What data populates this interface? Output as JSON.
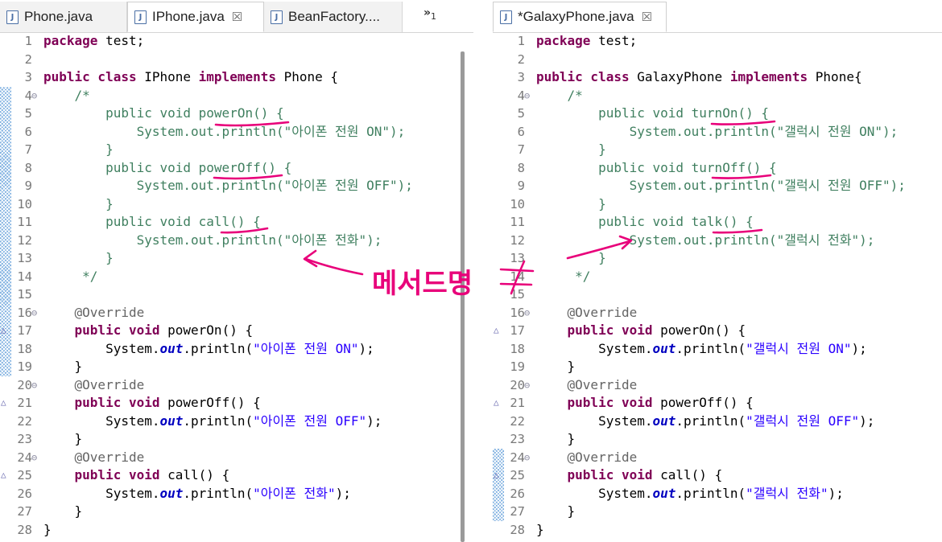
{
  "left_editor": {
    "tabs": [
      {
        "label": "Phone.java",
        "active": false,
        "closable": false
      },
      {
        "label": "IPhone.java",
        "active": true,
        "closable": true
      },
      {
        "label": "BeanFactory....",
        "active": false,
        "closable": false
      }
    ],
    "overflow_label": "»",
    "overflow_count": "1",
    "lines": [
      {
        "n": "1",
        "html": "<span class=\"kw\">package</span> test;"
      },
      {
        "n": "2",
        "html": ""
      },
      {
        "n": "3",
        "html": "<span class=\"kw\">public class</span> IPhone <span class=\"kw\">implements</span> Phone {"
      },
      {
        "n": "4",
        "fold": "⊖",
        "html": "    <span class=\"cm\">/*</span>"
      },
      {
        "n": "5",
        "html": "<span class=\"cm\">        public void powerOn() {</span>"
      },
      {
        "n": "6",
        "html": "<span class=\"cm\">            System.out.println(\"아이폰 전원 ON\");</span>"
      },
      {
        "n": "7",
        "html": "<span class=\"cm\">        }</span>"
      },
      {
        "n": "8",
        "html": "<span class=\"cm\">        public void powerOff() {</span>"
      },
      {
        "n": "9",
        "html": "<span class=\"cm\">            System.out.println(\"아이폰 전원 OFF\");</span>"
      },
      {
        "n": "10",
        "html": "<span class=\"cm\">        }</span>"
      },
      {
        "n": "11",
        "html": "<span class=\"cm\">        public void call() {</span>"
      },
      {
        "n": "12",
        "html": "<span class=\"cm\">            System.out.println(\"아이폰 전화\");</span>"
      },
      {
        "n": "13",
        "html": "<span class=\"cm\">        }</span>"
      },
      {
        "n": "14",
        "html": "<span class=\"cm\">     */</span>"
      },
      {
        "n": "15",
        "html": ""
      },
      {
        "n": "16",
        "fold": "⊖",
        "html": "    <span class=\"an\">@Override</span>"
      },
      {
        "n": "17",
        "ovr": true,
        "html": "    <span class=\"kw\">public void</span> powerOn() {"
      },
      {
        "n": "18",
        "html": "        System.<span class=\"fld\">out</span>.println(<span class=\"st\">\"아이폰 전원 ON\"</span>);"
      },
      {
        "n": "19",
        "html": "    }"
      },
      {
        "n": "20",
        "fold": "⊖",
        "html": "    <span class=\"an\">@Override</span>"
      },
      {
        "n": "21",
        "ovr": true,
        "html": "    <span class=\"kw\">public void</span> powerOff() {"
      },
      {
        "n": "22",
        "html": "        System.<span class=\"fld\">out</span>.println(<span class=\"st\">\"아이폰 전원 OFF\"</span>);"
      },
      {
        "n": "23",
        "html": "    }"
      },
      {
        "n": "24",
        "fold": "⊖",
        "html": "    <span class=\"an\">@Override</span>"
      },
      {
        "n": "25",
        "ovr": true,
        "html": "    <span class=\"kw\">public void</span> call() {"
      },
      {
        "n": "26",
        "html": "        System.<span class=\"fld\">out</span>.println(<span class=\"st\">\"아이폰 전화\"</span>);"
      },
      {
        "n": "27",
        "html": "    }"
      },
      {
        "n": "28",
        "html": "}"
      }
    ]
  },
  "right_editor": {
    "tabs": [
      {
        "label": "*GalaxyPhone.java",
        "active": true,
        "closable": true
      }
    ],
    "lines": [
      {
        "n": "1",
        "html": "<span class=\"kw\">package</span> test;"
      },
      {
        "n": "2",
        "html": ""
      },
      {
        "n": "3",
        "html": "<span class=\"kw\">public class</span> GalaxyPhone <span class=\"kw\">implements</span> Phone{"
      },
      {
        "n": "4",
        "fold": "⊖",
        "html": "    <span class=\"cm\">/*</span>"
      },
      {
        "n": "5",
        "html": "<span class=\"cm\">        public void turnOn() {</span>"
      },
      {
        "n": "6",
        "html": "<span class=\"cm\">            System.out.println(\"갤럭시 전원 ON\");</span>"
      },
      {
        "n": "7",
        "html": "<span class=\"cm\">        }</span>"
      },
      {
        "n": "8",
        "html": "<span class=\"cm\">        public void turnOff() {</span>"
      },
      {
        "n": "9",
        "html": "<span class=\"cm\">            System.out.println(\"갤럭시 전원 OFF\");</span>"
      },
      {
        "n": "10",
        "html": "<span class=\"cm\">        }</span>"
      },
      {
        "n": "11",
        "html": "<span class=\"cm\">        public void talk() {</span>"
      },
      {
        "n": "12",
        "html": "<span class=\"cm\">            System.out.println(\"갤럭시 전화\");</span>"
      },
      {
        "n": "13",
        "html": "<span class=\"cm\">        }</span>"
      },
      {
        "n": "14",
        "html": "<span class=\"cm\">     */</span>"
      },
      {
        "n": "15",
        "html": ""
      },
      {
        "n": "16",
        "fold": "⊖",
        "html": "    <span class=\"an\">@Override</span>"
      },
      {
        "n": "17",
        "ovr": true,
        "html": "    <span class=\"kw\">public void</span> powerOn() {"
      },
      {
        "n": "18",
        "html": "        System.<span class=\"fld\">out</span>.println(<span class=\"st\">\"갤럭시 전원 ON\"</span>);"
      },
      {
        "n": "19",
        "html": "    }"
      },
      {
        "n": "20",
        "fold": "⊖",
        "html": "    <span class=\"an\">@Override</span>"
      },
      {
        "n": "21",
        "ovr": true,
        "html": "    <span class=\"kw\">public void</span> powerOff() {"
      },
      {
        "n": "22",
        "html": "        System.<span class=\"fld\">out</span>.println(<span class=\"st\">\"갤럭시 전원 OFF\"</span>);"
      },
      {
        "n": "23",
        "html": "    }"
      },
      {
        "n": "24",
        "fold": "⊖",
        "html": "    <span class=\"an\">@Override</span>"
      },
      {
        "n": "25",
        "ovr": true,
        "html": "    <span class=\"kw\">public void</span> call() {"
      },
      {
        "n": "26",
        "html": "        System.<span class=\"fld\">out</span>.println(<span class=\"st\">\"갤럭시 전화\"</span>);"
      },
      {
        "n": "27",
        "html": "    }"
      },
      {
        "n": "28",
        "html": "}"
      }
    ]
  },
  "annotation": {
    "label": "메서드명",
    "symbol": "≠",
    "color": "#e8007a"
  },
  "colors": {
    "keyword": "#7f0055",
    "comment": "#3f7f5f",
    "string": "#2a00ff",
    "field": "#0000c0",
    "annotation": "#646464",
    "line_number": "#787878"
  }
}
